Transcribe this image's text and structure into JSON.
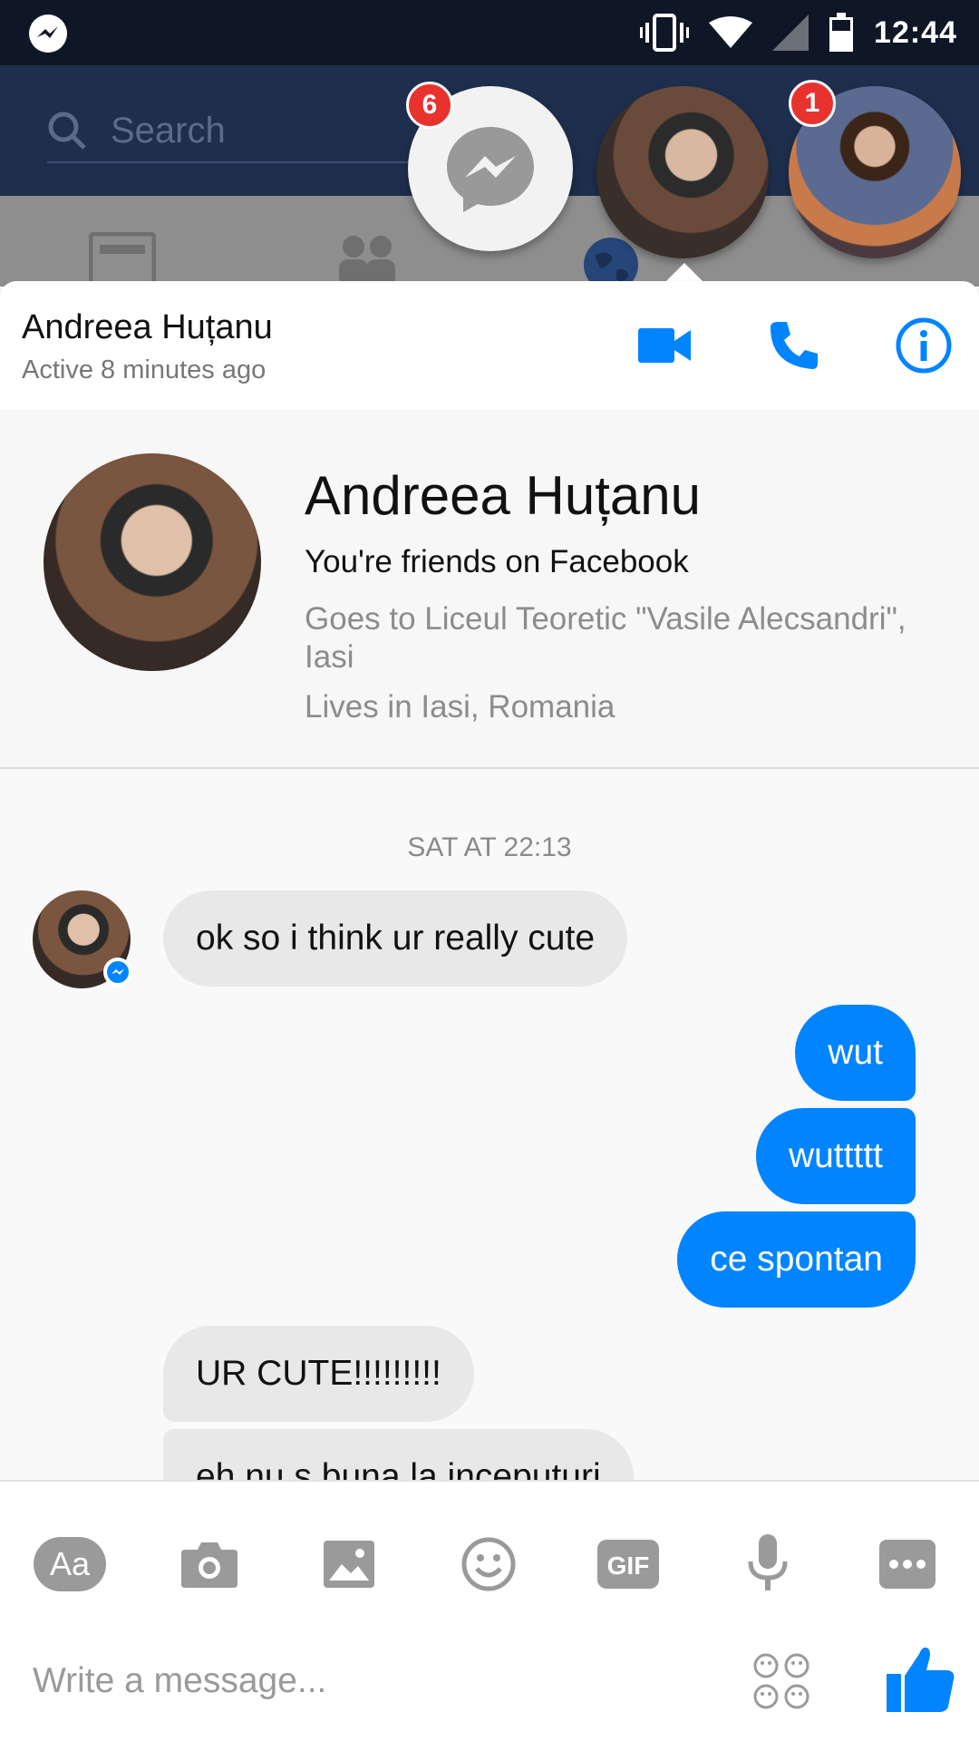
{
  "status_bar": {
    "time": "12:44"
  },
  "underlay": {
    "search_placeholder": "Search"
  },
  "chat_heads": {
    "messenger_badge": "6",
    "contact_badge": "1"
  },
  "chat_header": {
    "name": "Andreea Huțanu",
    "status": "Active 8 minutes ago"
  },
  "profile": {
    "name": "Andreea Huțanu",
    "friends_text": "You're friends on Facebook",
    "school": "Goes to Liceul Teoretic \"Vasile Alecsandri\", Iasi",
    "lives": "Lives in Iasi, Romania"
  },
  "conversation": {
    "timestamp": "SAT AT 22:13",
    "messages": [
      {
        "from": "them",
        "text": "ok so i think ur really cute"
      },
      {
        "from": "me",
        "text": "wut"
      },
      {
        "from": "me",
        "text": "wuttttt"
      },
      {
        "from": "me",
        "text": "ce spontan"
      },
      {
        "from": "them",
        "text": "UR CUTE!!!!!!!!!"
      },
      {
        "from": "them",
        "text": "eh nu s buna la inceputuri"
      }
    ]
  },
  "composer": {
    "text_tool_label": "Aa",
    "gif_label": "GIF",
    "placeholder": "Write a message..."
  },
  "colors": {
    "accent": "#0084ff",
    "badge": "#e8322e",
    "status_bar": "#0f1726",
    "app_bar": "#1e2f4e"
  }
}
